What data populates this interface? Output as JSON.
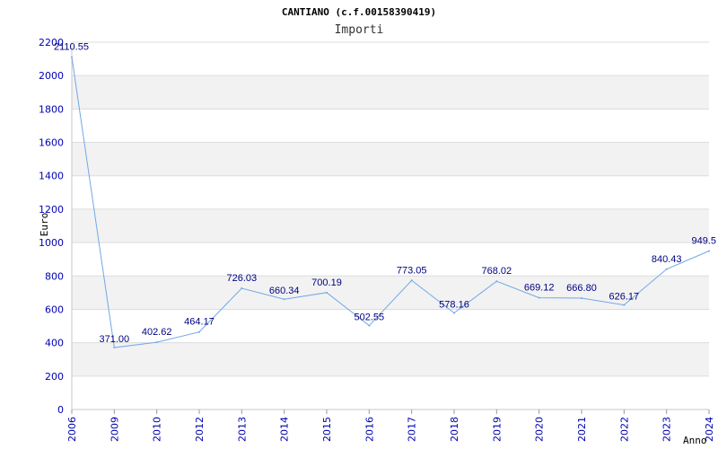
{
  "chart_data": {
    "type": "line",
    "title": "CANTIANO (c.f.00158390419)",
    "subtitle": "Importi",
    "xlabel": "Anno",
    "ylabel": "Euro",
    "ylim": [
      0,
      2200
    ],
    "yticks": [
      0,
      200,
      400,
      600,
      800,
      1000,
      1200,
      1400,
      1600,
      1800,
      2000,
      2200
    ],
    "categories": [
      "2006",
      "2009",
      "2010",
      "2012",
      "2013",
      "2014",
      "2015",
      "2016",
      "2017",
      "2018",
      "2019",
      "2020",
      "2021",
      "2022",
      "2023",
      "2024"
    ],
    "values": [
      2110.55,
      371.0,
      402.62,
      464.17,
      726.03,
      660.34,
      700.19,
      502.55,
      773.05,
      578.16,
      768.02,
      669.12,
      666.8,
      626.17,
      840.43,
      949.5
    ],
    "labels": [
      "2110.55",
      "371.00",
      "402.62",
      "464.17",
      "726.03",
      "660.34",
      "700.19",
      "502.55",
      "773.05",
      "578.16",
      "768.02",
      "669.12",
      "666.80",
      "626.17",
      "840.43",
      "949.5"
    ],
    "grid": true,
    "line_color": "#6fa8e8",
    "band_color": "#f2f2f2"
  }
}
